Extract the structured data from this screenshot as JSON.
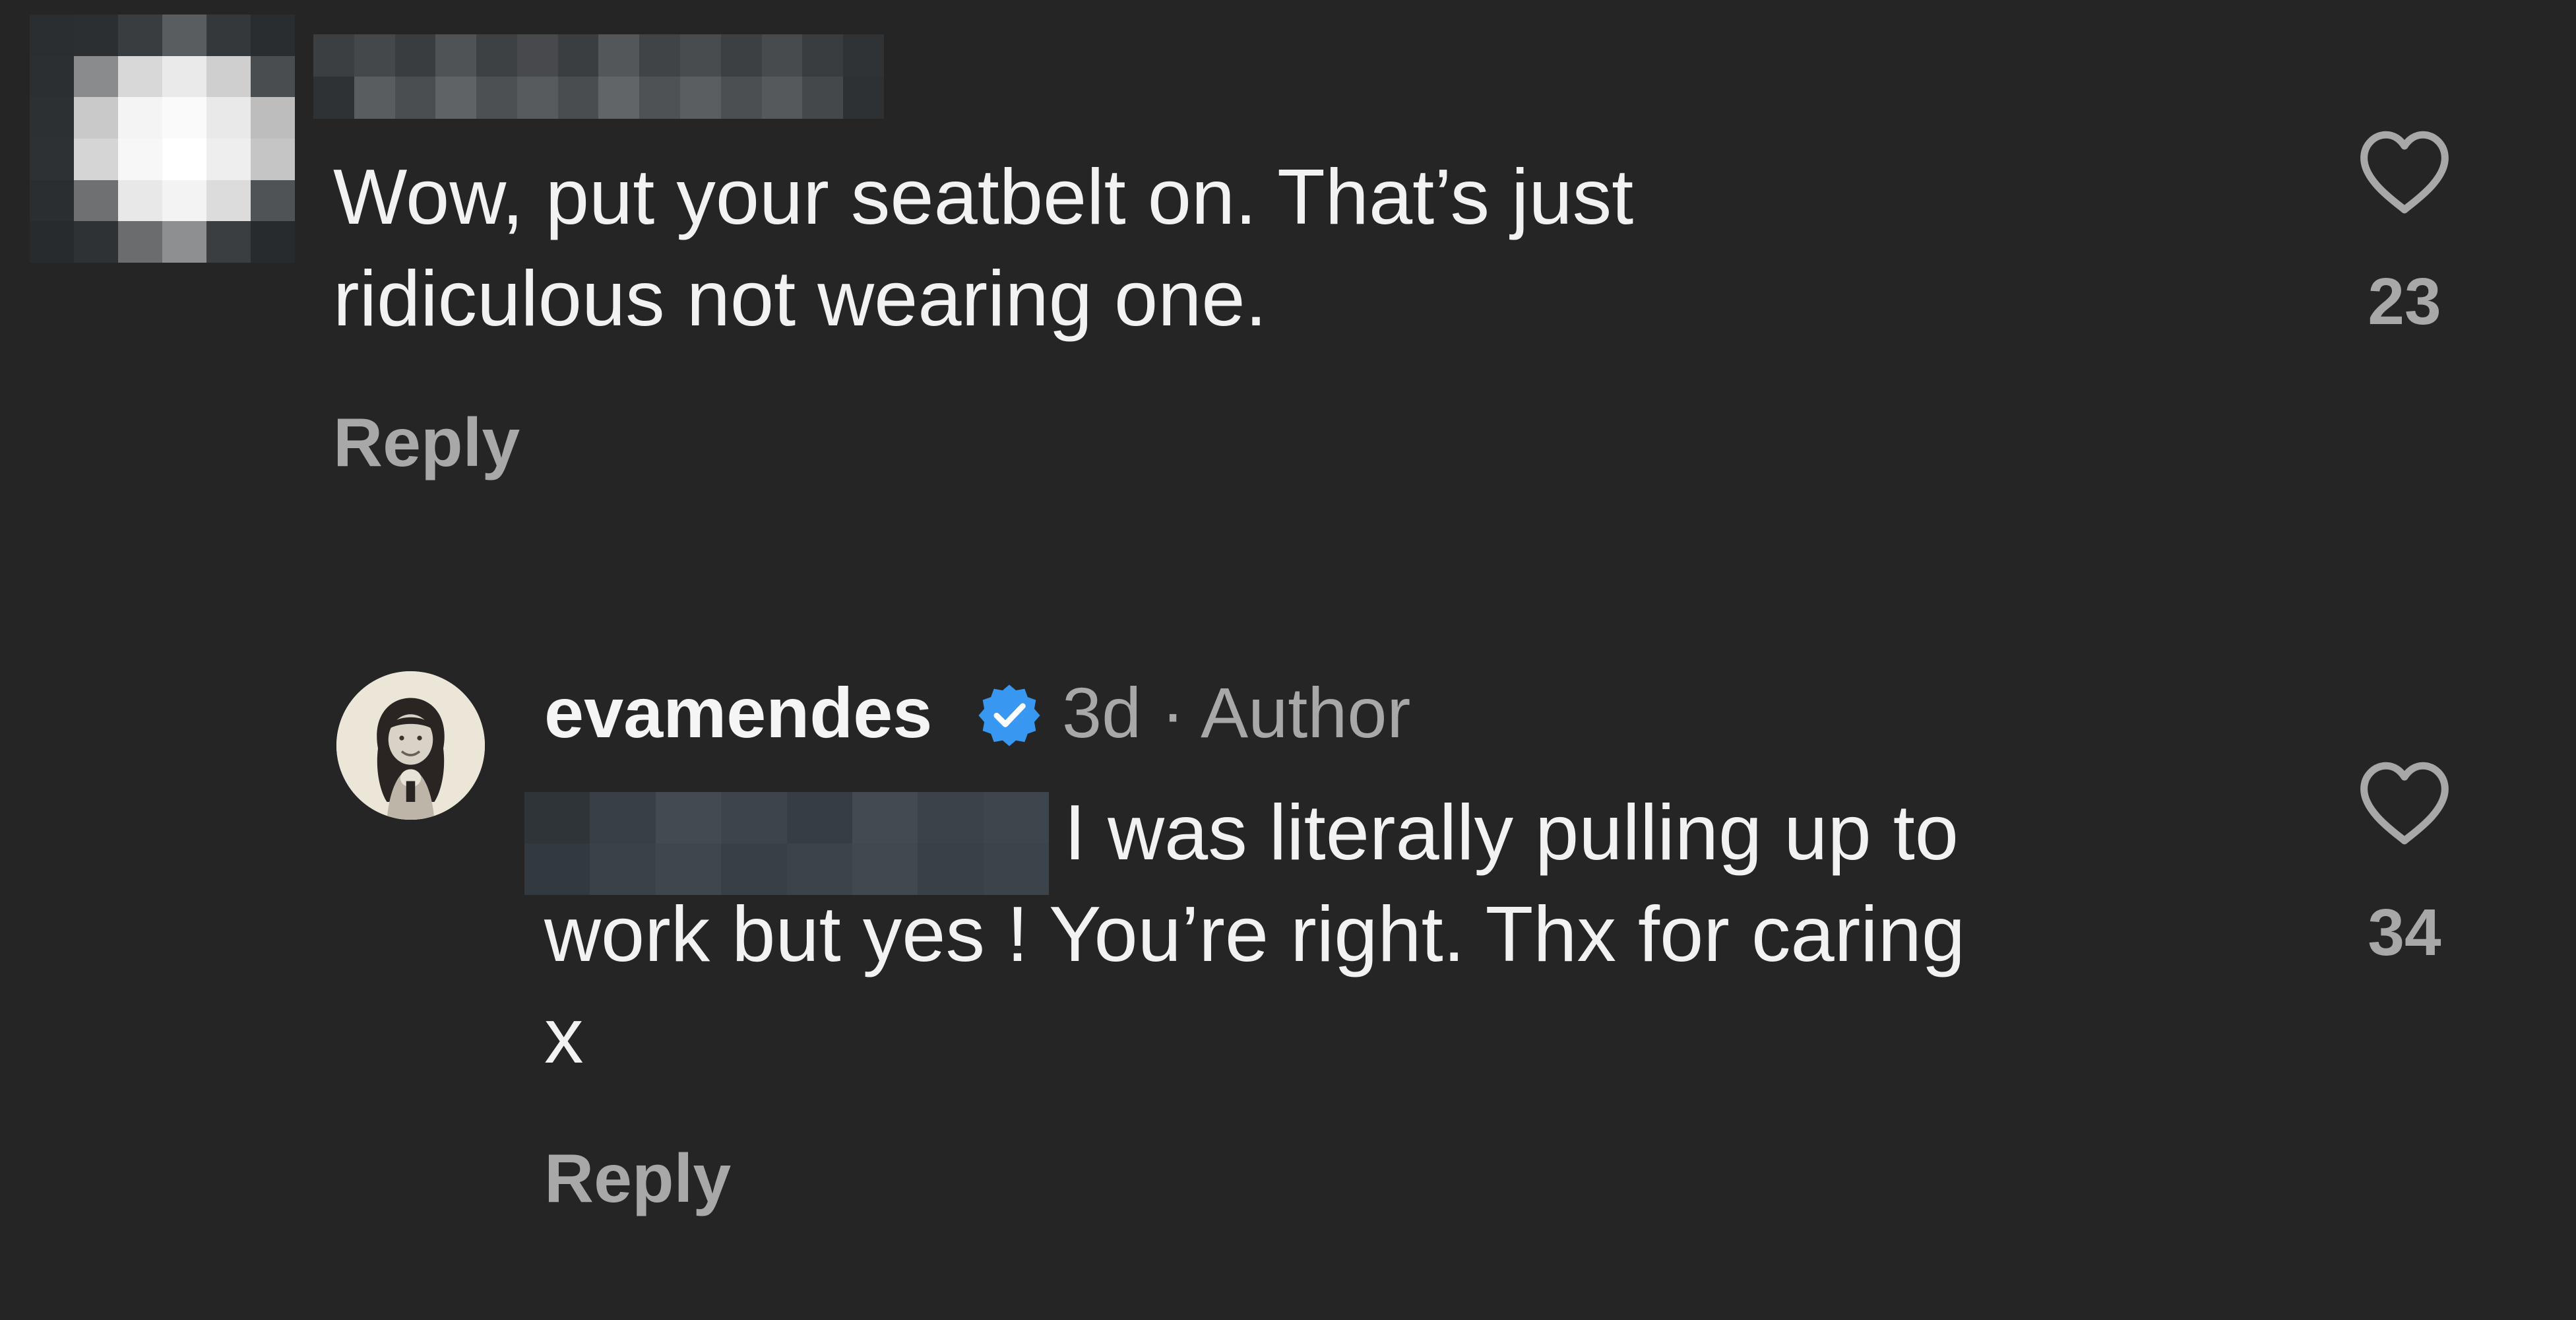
{
  "top_comment": {
    "text_line1": "Wow, put your seatbelt on. That’s just",
    "text_line2": "ridiculous not wearing one.",
    "reply_label": "Reply",
    "like_count": "23"
  },
  "author_reply": {
    "username": "evamendes",
    "time": "3d",
    "separator": "·",
    "role": "Author",
    "text_line1": "I was literally pulling up to",
    "text_line2": "work but yes ! You’re right. Thx for caring",
    "text_line3": "x",
    "reply_label": "Reply",
    "like_count": "34"
  },
  "icons": {
    "like": "heart-outline-icon",
    "verified": "verified-badge-icon"
  },
  "colors": {
    "background": "#252525",
    "text_primary": "#f5f5f5",
    "text_secondary": "#a8a8a8",
    "verified_blue": "#3897f0"
  }
}
